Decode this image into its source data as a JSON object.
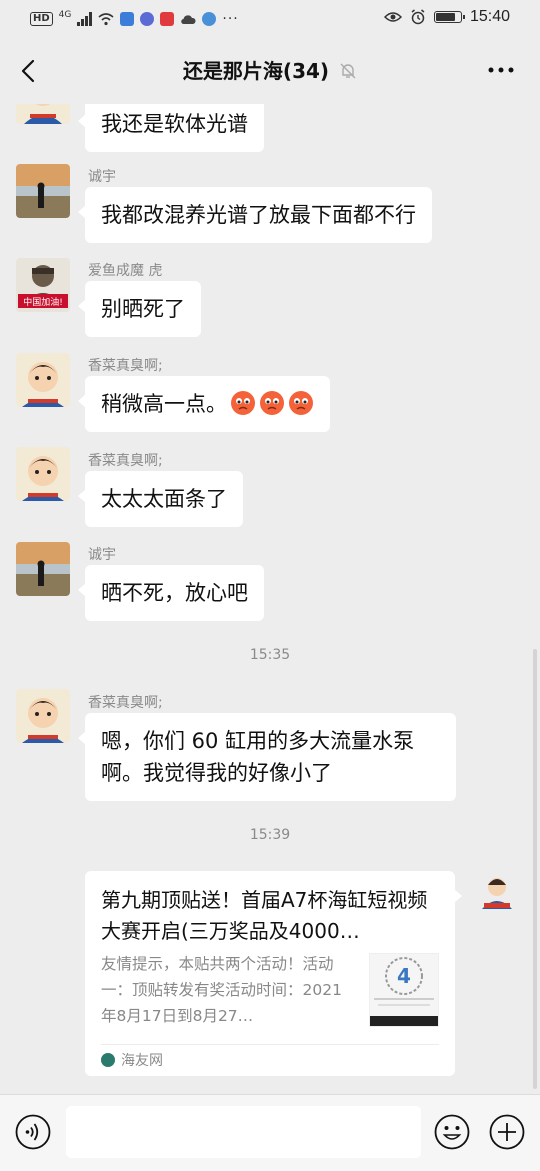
{
  "status_bar": {
    "hd_label": "HD",
    "signal_label": "4G",
    "time": "15:40",
    "battery_level": 0.85,
    "more_label": "···"
  },
  "nav": {
    "title": "还是那片海(34)"
  },
  "messages": [
    {
      "sender": "",
      "text": "我还是软体光谱"
    },
    {
      "sender": "诚宇",
      "text": "我都改混养光谱了放最下面都不行"
    },
    {
      "sender": "爱鱼成魔 虎",
      "text": "别晒死了",
      "avatar_text": "中国加油!"
    },
    {
      "sender": "香菜真臭啊;",
      "text": "稍微高一点。"
    },
    {
      "sender": "香菜真臭啊;",
      "text": "太太太面条了"
    },
    {
      "sender": "诚宇",
      "text": "晒不死，放心吧"
    },
    {
      "sender": "香菜真臭啊;",
      "text": "嗯，你们 60 缸用的多大流量水泵啊。我觉得我的好像小了"
    }
  ],
  "timestamps": [
    "15:35",
    "15:39"
  ],
  "link_card": {
    "title": "第九期顶贴送！首届A7杯海缸短视频大赛开启(三万奖品及4000…",
    "description": "友情提示，本贴共两个活动！活动一：顶贴转发有奖活动时间：2021年8月17日到8月27…",
    "source": "海友网"
  },
  "input": {
    "value": "",
    "placeholder": ""
  },
  "colors": {
    "background": "#ededed",
    "bubble": "#ffffff",
    "muted_text": "#8a8a8a"
  }
}
